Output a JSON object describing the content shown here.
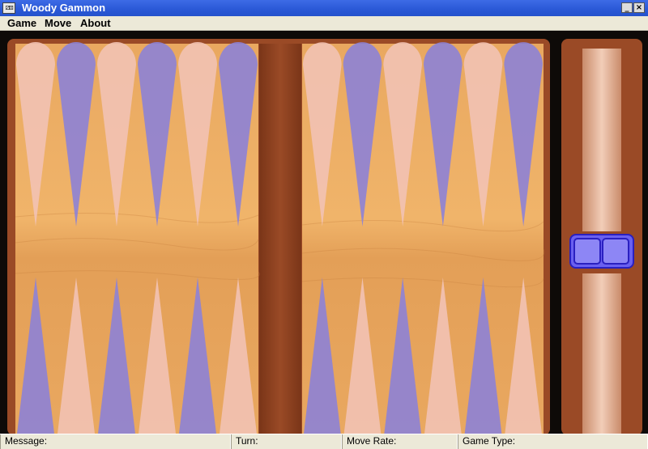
{
  "window": {
    "title": "Woody Gammon",
    "app_icon": "dice-icon",
    "app_icon_text": "⚂⚄",
    "minimize_symbol": "_",
    "close_symbol": "×"
  },
  "menu": {
    "items": [
      "Game",
      "Move",
      "About"
    ]
  },
  "status": {
    "message_label": "Message:",
    "turn_label": "Turn:",
    "move_rate_label": "Move Rate:",
    "game_type_label": "Game Type:"
  },
  "board": {
    "points_per_quadrant": 6,
    "colors": {
      "wood_surface": "#e8a75c",
      "frame": "#9a4a26",
      "bar": "#8a3f1f",
      "point_light": "#f2c2b4",
      "point_purple": "#8d82d6",
      "dice_box": "#3a30e0",
      "background": "#0e0a08"
    }
  }
}
